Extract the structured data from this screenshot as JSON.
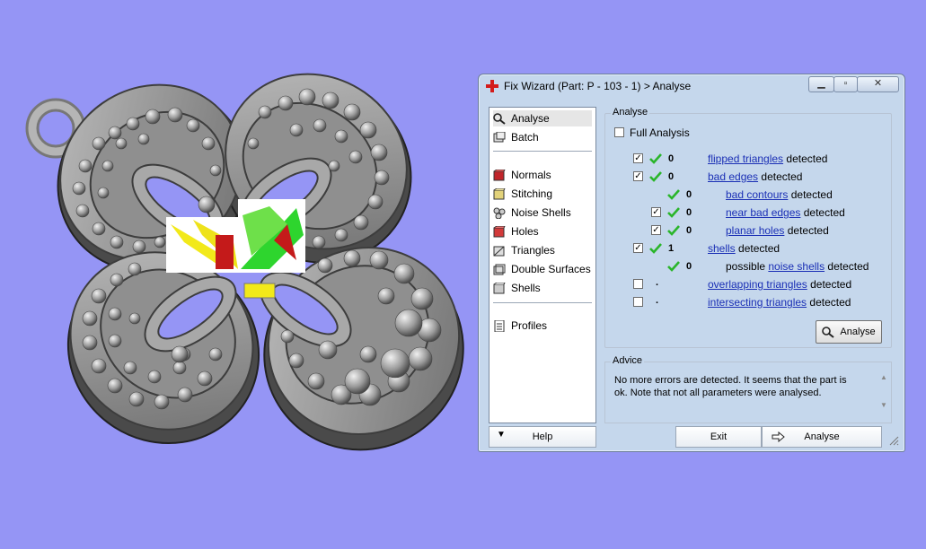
{
  "window": {
    "title": "Fix Wizard (Part: P - 103 - 1) > Analyse",
    "minimize_icon": "minimize-icon",
    "maximize_icon": "maximize-icon",
    "close_icon": "close-icon"
  },
  "sidebar": {
    "top_items": [
      {
        "label": "Analyse",
        "icon": "magnifier-icon",
        "selected": true
      },
      {
        "label": "Batch",
        "icon": "batch-icon"
      }
    ],
    "mid_items": [
      {
        "label": "Normals",
        "icon": "normals-cube-icon",
        "color": "#c0242a"
      },
      {
        "label": "Stitching",
        "icon": "stitching-cube-icon",
        "color": "#e2d27a"
      },
      {
        "label": "Noise Shells",
        "icon": "noise-shells-icon"
      },
      {
        "label": "Holes",
        "icon": "holes-cube-icon",
        "color": "#c0242a"
      },
      {
        "label": "Triangles",
        "icon": "triangles-cube-icon"
      },
      {
        "label": "Double Surfaces",
        "icon": "double-surfaces-icon"
      },
      {
        "label": "Shells",
        "icon": "shells-cube-icon"
      }
    ],
    "bottom_items": [
      {
        "label": "Profiles",
        "icon": "profiles-icon"
      }
    ]
  },
  "analyse": {
    "legend": "Analyse",
    "full_analysis": "Full Analysis",
    "rows": [
      {
        "count": "0",
        "link": "flipped triangles",
        "suffix": "detected",
        "checked": true,
        "ok": true
      },
      {
        "count": "0",
        "link": "bad edges",
        "suffix": "detected",
        "checked": true,
        "ok": true
      },
      {
        "count": "0",
        "link": "bad contours",
        "suffix": "detected",
        "checked": null,
        "ok": true
      },
      {
        "count": "0",
        "link": "near bad edges",
        "suffix": "detected",
        "checked": true,
        "ok": true
      },
      {
        "count": "0",
        "link": "planar holes",
        "suffix": "detected",
        "checked": true,
        "ok": true
      },
      {
        "count": "1",
        "link": "shells",
        "suffix": "detected",
        "checked": true,
        "ok": true
      },
      {
        "count": "0",
        "prefix": "possible",
        "link": "noise shells",
        "suffix": "detected",
        "checked": null,
        "ok": true
      },
      {
        "count": ".",
        "link": "overlapping triangles",
        "suffix": "detected",
        "checked": false,
        "ok": false
      },
      {
        "count": ".",
        "link": "intersecting triangles",
        "suffix": "detected",
        "checked": false,
        "ok": false
      }
    ],
    "button_label": "Analyse",
    "button_icon": "magnifier-icon"
  },
  "advice": {
    "legend": "Advice",
    "text": "No more errors are detected. It seems that the part is ok. Note that not all parameters were analysed."
  },
  "bottom_bar": {
    "help_label": "Help",
    "help_icon": "triangle-down-icon",
    "exit_label": "Exit",
    "analyse_label": "Analyse",
    "analyse_icon": "arrow-right-icon",
    "grip_icon": "resize-grip-icon"
  },
  "colors": {
    "background": "#9595f5",
    "window": "#c5d7ec",
    "check": "#2ab52a",
    "link": "#1a2fb5"
  }
}
